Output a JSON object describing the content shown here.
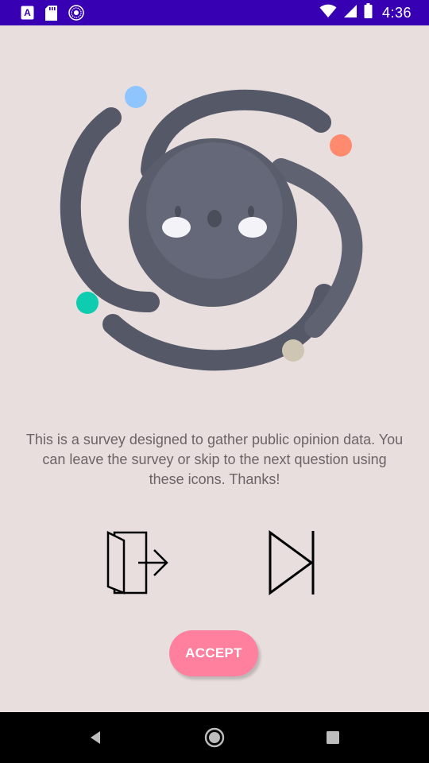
{
  "status_bar": {
    "time": "4:36",
    "background": "#3700B3",
    "icons": [
      "a11y-font-icon",
      "sd-card-icon",
      "circle-pattern-icon",
      "wifi-icon",
      "cell-signal-icon",
      "battery-icon"
    ]
  },
  "hero": {
    "name": "swirl-creature-illustration",
    "colors": {
      "body": "#5F6270",
      "swirl": "#555866",
      "eyes": "#F4F4F8",
      "dot_blue": "#8EC5FF",
      "dot_orange": "#FF8A6E",
      "dot_teal": "#0ECCB0",
      "dot_beige": "#CFC5B3"
    }
  },
  "message": {
    "text": "This is a survey designed to gather public opinion data. You can leave the survey or skip to the next question using these icons. Thanks!"
  },
  "actions": {
    "exit_icon": "exit-door-icon",
    "skip_icon": "skip-next-icon"
  },
  "accept_button": {
    "label": "ACCEPT",
    "color": "#FF7F9F"
  },
  "nav_bar": {
    "icons": [
      "back-icon",
      "home-icon",
      "recents-icon"
    ]
  }
}
